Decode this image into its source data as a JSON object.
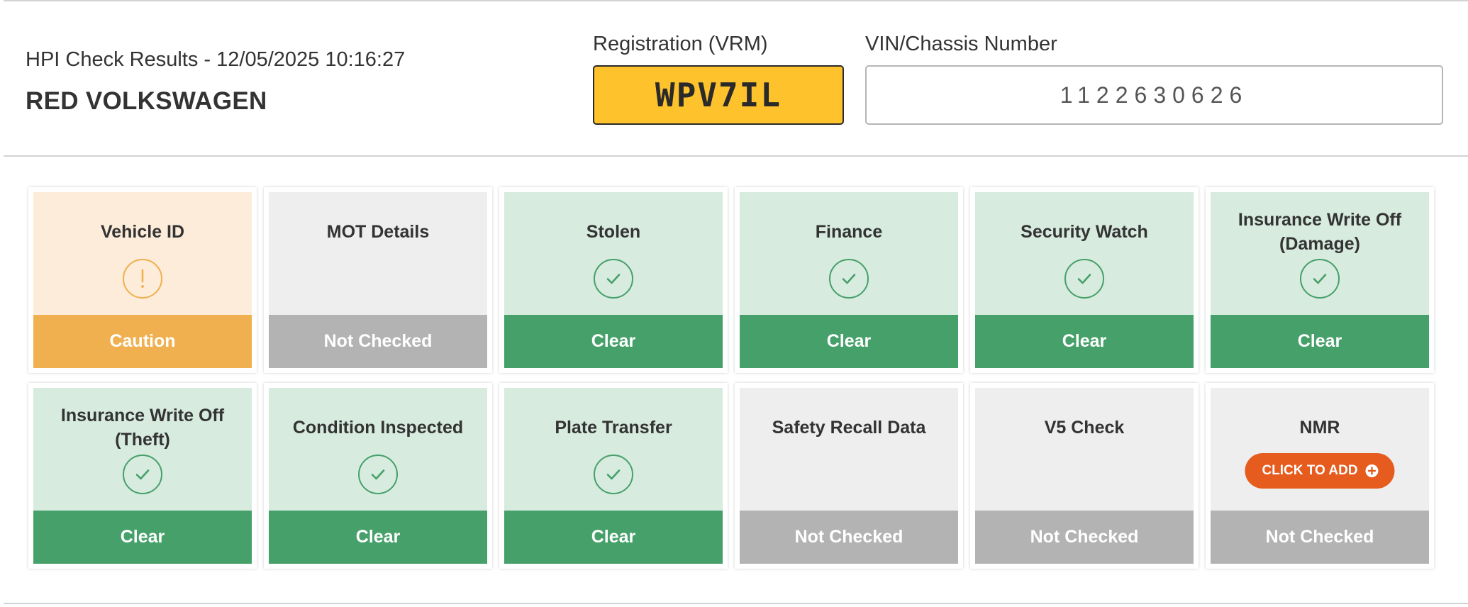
{
  "header": {
    "date_text": "HPI Check Results - 12/05/2025 10:16:27",
    "vehicle_title": "RED VOLKSWAGEN",
    "registration_label": "Registration (VRM)",
    "registration_value": "WPV7IL",
    "vin_label": "VIN/Chassis Number",
    "vin_value": "1122630626"
  },
  "checks": [
    {
      "title": "Vehicle ID",
      "status": "Caution",
      "state": "caution",
      "icon": "exclamation-icon"
    },
    {
      "title": "MOT Details",
      "status": "Not Checked",
      "state": "none",
      "icon": ""
    },
    {
      "title": "Stolen",
      "status": "Clear",
      "state": "clear",
      "icon": "check-icon"
    },
    {
      "title": "Finance",
      "status": "Clear",
      "state": "clear",
      "icon": "check-icon"
    },
    {
      "title": "Security Watch",
      "status": "Clear",
      "state": "clear",
      "icon": "check-icon"
    },
    {
      "title": "Insurance Write Off (Damage)",
      "status": "Clear",
      "state": "clear",
      "icon": "check-icon"
    },
    {
      "title": "Insurance Write Off (Theft)",
      "status": "Clear",
      "state": "clear",
      "icon": "check-icon"
    },
    {
      "title": "Condition Inspected",
      "status": "Clear",
      "state": "clear",
      "icon": "check-icon"
    },
    {
      "title": "Plate Transfer",
      "status": "Clear",
      "state": "clear",
      "icon": "check-icon"
    },
    {
      "title": "Safety Recall Data",
      "status": "Not Checked",
      "state": "none",
      "icon": ""
    },
    {
      "title": "V5 Check",
      "status": "Not Checked",
      "state": "none",
      "icon": ""
    },
    {
      "title": "NMR",
      "status": "Not Checked",
      "state": "none",
      "icon": "",
      "button_label": "CLICK TO ADD"
    }
  ],
  "colors": {
    "clear_light": "#d7ebdf",
    "clear": "#46a06a",
    "caution_light": "#fcecd9",
    "caution": "#f0b04f",
    "not_checked_light": "#eeeeee",
    "not_checked": "#b3b3b3",
    "plate_yellow": "#fec32c",
    "add_button": "#e65c1e"
  }
}
